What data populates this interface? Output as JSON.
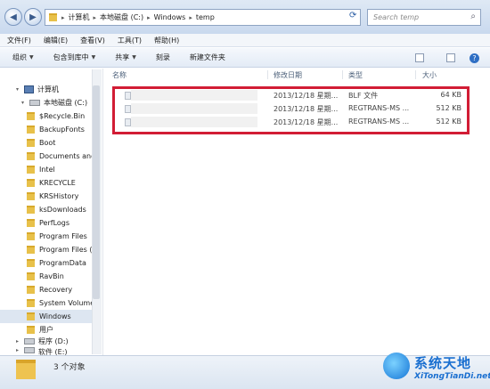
{
  "address_bar": {
    "crumbs": [
      "计算机",
      "本地磁盘 (C:)",
      "Windows",
      "temp"
    ],
    "search_placeholder": "Search temp"
  },
  "menu": [
    "文件(F)",
    "编辑(E)",
    "查看(V)",
    "工具(T)",
    "帮助(H)"
  ],
  "toolbar": {
    "organize": "组织",
    "include_library": "包含到库中",
    "share": "共享",
    "burn": "刻录",
    "new_folder": "新建文件夹"
  },
  "nav": {
    "computer": "计算机",
    "local_disk": "本地磁盘 (C:)",
    "folders": [
      "$Recycle.Bin",
      "BackupFonts",
      "Boot",
      "Documents and",
      "Intel",
      "KRECYCLE",
      "KRSHistory",
      "ksDownloads",
      "PerfLogs",
      "Program Files",
      "Program Files (",
      "ProgramData",
      "RavBin",
      "Recovery",
      "System Volume",
      "Windows",
      "用户"
    ],
    "drive_d": "程序 (D:)",
    "drive_e": "软件 (E:)"
  },
  "columns": {
    "name": "名称",
    "modified": "修改日期",
    "type": "类型",
    "size": "大小"
  },
  "files": [
    {
      "modified": "2013/12/18 星期...",
      "type": "BLF 文件",
      "size": "64 KB"
    },
    {
      "modified": "2013/12/18 星期...",
      "type": "REGTRANS-MS ...",
      "size": "512 KB"
    },
    {
      "modified": "2013/12/18 星期...",
      "type": "REGTRANS-MS ...",
      "size": "512 KB"
    }
  ],
  "status": {
    "count": "3 个对象"
  },
  "watermark": {
    "title": "系统天地",
    "url": "XiTongTianDi.net"
  },
  "colors": {
    "highlight_border": "#d21d35",
    "watermark": "#1a6fd0"
  }
}
